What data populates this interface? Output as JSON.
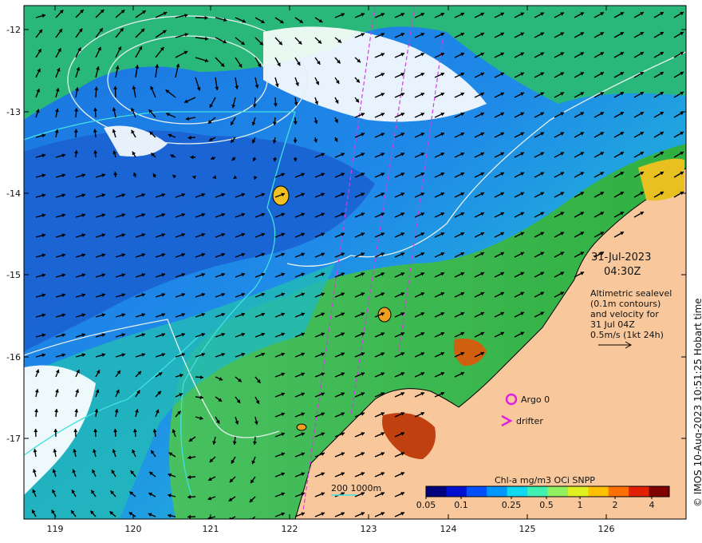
{
  "map": {
    "date": "31-Jul-2023",
    "time": "04:30Z",
    "legend_lines": [
      "Altimetric sealevel",
      "(0.1m contours)",
      "and velocity for",
      "31 Jul 04Z",
      "0.5m/s (1kt 24h)"
    ],
    "markers": {
      "argo_label": "Argo 0",
      "drifter_label": "drifter",
      "marker_color": "#e020e0"
    },
    "depth_label": "200  1000m",
    "colorbar": {
      "title": "Chl-a mg/m3 OCi SNPP",
      "tick_labels": [
        "0.05",
        "0.1",
        "0.25",
        "0.5",
        "1",
        "2",
        "4"
      ],
      "colors": [
        "#00007f",
        "#0010d0",
        "#0050ff",
        "#0098ff",
        "#10d8f0",
        "#40f0b0",
        "#90f060",
        "#e0f020",
        "#ffc000",
        "#ff7000",
        "#e02000",
        "#800000"
      ]
    },
    "credit": "© IMOS 10-Aug-2023 10:51:25 Hobart time",
    "x_ticks": [
      "119",
      "120",
      "121",
      "122",
      "123",
      "124",
      "125",
      "126"
    ],
    "y_ticks": [
      "-12",
      "-13",
      "-14",
      "-15",
      "-16",
      "-17"
    ],
    "colors": {
      "land": "#f8c89c",
      "contour": "#e6f0f0",
      "bathy": "#40e0e0",
      "ocean_deep": "#1f6fd8",
      "ocean_mid": "#20c0e0",
      "shelf": "#30b040"
    }
  }
}
